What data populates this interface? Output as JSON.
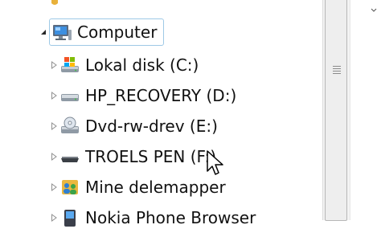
{
  "tree": {
    "root": {
      "label": "Computer",
      "icon": "computer-icon",
      "expanded": true
    },
    "items": [
      {
        "label": "Lokal disk (C:)",
        "icon": "local-disk-icon"
      },
      {
        "label": "HP_RECOVERY (D:)",
        "icon": "hard-drive-icon"
      },
      {
        "label": "Dvd-rw-drev (E:)",
        "icon": "dvd-drive-icon"
      },
      {
        "label": "TROELS PEN (F:)",
        "icon": "usb-drive-icon"
      },
      {
        "label": "Mine delemapper",
        "icon": "shared-folders-icon"
      },
      {
        "label": "Nokia Phone Browser",
        "icon": "phone-icon"
      }
    ]
  },
  "colors": {
    "selection_border": "#9ec9e6",
    "text": "#111111",
    "scrollbar_track": "#f3f3f3",
    "scrollbar_thumb": "#eeeeee"
  }
}
